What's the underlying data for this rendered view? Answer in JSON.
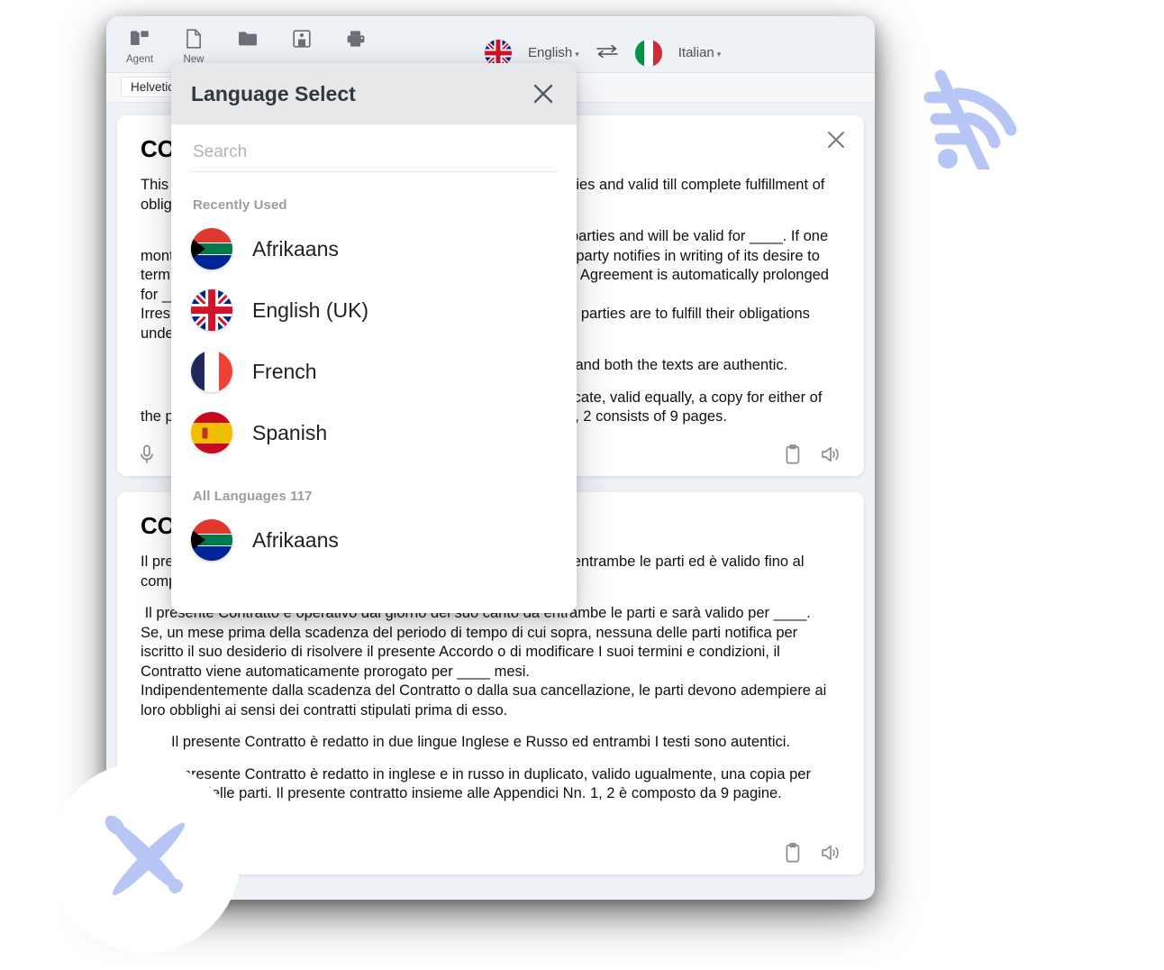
{
  "app": {
    "toolbar": {
      "items": [
        {
          "label": "Agent",
          "icon": "agent-folder-icon"
        },
        {
          "label": "New",
          "icon": "new-document-icon"
        },
        {
          "label": "",
          "icon": "open-folder-icon"
        },
        {
          "label": "",
          "icon": "save-icon"
        },
        {
          "label": "",
          "icon": "print-icon"
        }
      ],
      "truncated_label": "ge",
      "source_language": "English",
      "source_flag": "uk-flag-icon",
      "target_language": "Italian",
      "target_flag": "italy-flag-icon",
      "swap_icon": "swap-arrows-icon",
      "caret": "▾"
    },
    "fontbar": {
      "font_name": "Helvetica"
    }
  },
  "documents": [
    {
      "id": "english",
      "title": "CONTRACT",
      "close_icon": "close-icon",
      "paragraphs": [
        "This Contract is operative from the date of signing by the both parties and valid till complete fulfillment of obligations.",
        "This Contract is operative from the day of its signing by both parties and will be valid for ____. If one month prior to the expiration of the above-mentioned time, neither party notifies in writing of its desire to terminate this Agreement or to modify its terms and conditions, the Agreement is automatically prolonged for ____ months.\nIrrespective of the expiration of the Contract or its cancellation, the parties are to fulfill their obligations under the contracts concluded prior to it.",
        "This Contract is made in two languages English and Russian and both the texts are authentic.",
        "The present Contract is made in English and Russian in duplicate, valid equally, a copy for either of the parties. The present Contract together with Appendixes Nos. 1, 2 consists of 9 pages."
      ],
      "tools_left": [
        "microphone-icon",
        "camera-icon"
      ],
      "tools_right": [
        "clipboard-icon",
        "speaker-icon"
      ]
    },
    {
      "id": "italian",
      "title": "CONTRATTO",
      "paragraphs": [
        "Il presente Contratto è operativo dalla data della firma da parte di entrambe le parti ed è valido fino al completo adempimento degli obblighi.",
        " Il presente Contratto è operativo dal giorno del suo canto da entrambe le parti e sarà valido per ____.\nSe, un mese prima della scadenza del periodo di tempo di cui sopra, nessuna delle parti notifica per iscritto il suo desiderio di risolvere il presente Accordo o di modificare I suoi termini e condizioni, il Contratto viene automaticamente prorogato per ____ mesi.\nIndipendentemente dalla scadenza del Contratto o dalla sua cancellazione, le parti devono adempiere ai loro obblighi ai sensi dei contratti stipulati prima di esso.",
        "Il presente Contratto è redatto in due lingue Inglese e Russo ed entrambi I testi sono autentici.",
        "Il presente Contratto è redatto in inglese e in russo in duplicato, valido ugualmente, una copia per ciascuna delle parti. Il presente contratto insieme alle Appendici Nn. 1, 2 è composto da 9 pagine."
      ],
      "tools_right": [
        "clipboard-icon",
        "speaker-icon"
      ]
    }
  ],
  "modal": {
    "title": "Language Select",
    "close_icon": "close-icon",
    "search_placeholder": "Search",
    "search_value": "",
    "recent_label": "Recently Used",
    "recent": [
      {
        "name": "Afrikaans",
        "flag": "south-africa-flag-icon"
      },
      {
        "name": "English (UK)",
        "flag": "uk-flag-icon"
      },
      {
        "name": "French",
        "flag": "france-flag-icon"
      },
      {
        "name": "Spanish",
        "flag": "spain-flag-icon"
      }
    ],
    "all_label": "All Languages 117",
    "all": [
      {
        "name": "Afrikaans",
        "flag": "south-africa-flag-icon"
      }
    ]
  },
  "decorations": {
    "wifi_icon": "wifi-off-icon",
    "plane_icon": "airplane-icon",
    "accent_color": "#b8c6f5"
  }
}
